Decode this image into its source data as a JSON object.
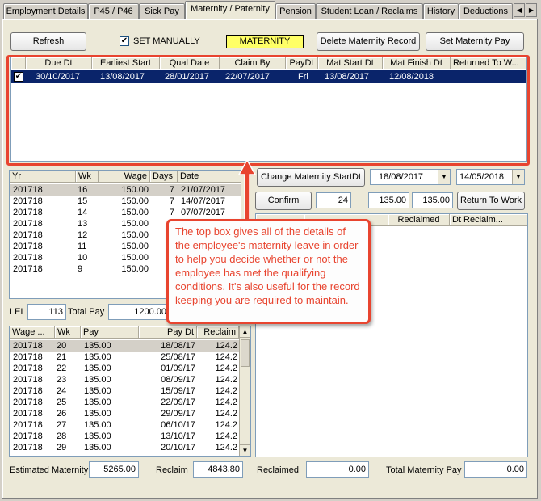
{
  "tabs": [
    "Employment Details",
    "P45 / P46",
    "Sick Pay",
    "Maternity / Paternity",
    "Pension",
    "Student Loan / Reclaims",
    "History",
    "Deductions"
  ],
  "toolbar": {
    "refresh": "Refresh",
    "set_manually": "SET MANUALLY",
    "maternity_badge": "MATERNITY",
    "delete_record": "Delete Maternity Record",
    "set_pay": "Set Maternity Pay"
  },
  "records": {
    "headers": [
      "Due Dt",
      "Earliest Start",
      "Qual Date",
      "Claim By",
      "PayDt",
      "Mat Start Dt",
      "Mat Finish Dt",
      "Returned To W..."
    ],
    "rows": [
      [
        "30/10/2017",
        "13/08/2017",
        "28/01/2017",
        "22/07/2017",
        "Fri",
        "13/08/2017",
        "12/08/2018",
        ""
      ]
    ]
  },
  "earnings": {
    "headers": [
      "Yr",
      "Wk",
      "Wage",
      "Days",
      "Date"
    ],
    "rows": [
      [
        "201718",
        "16",
        "150.00",
        "7",
        "21/07/2017"
      ],
      [
        "201718",
        "15",
        "150.00",
        "7",
        "14/07/2017"
      ],
      [
        "201718",
        "14",
        "150.00",
        "7",
        "07/07/2017"
      ],
      [
        "201718",
        "13",
        "150.00",
        "",
        ""
      ],
      [
        "201718",
        "12",
        "150.00",
        "",
        ""
      ],
      [
        "201718",
        "11",
        "150.00",
        "",
        ""
      ],
      [
        "201718",
        "10",
        "150.00",
        "",
        ""
      ],
      [
        "201718",
        "9",
        "150.00",
        "",
        ""
      ]
    ]
  },
  "lel": {
    "label": "LEL",
    "value": "113",
    "total_label": "Total Pay",
    "total_value": "1200.00"
  },
  "payments": {
    "headers": [
      "Wage ...",
      "Wk",
      "Pay",
      "Pay Dt",
      "Reclaim"
    ],
    "rows": [
      [
        "201718",
        "20",
        "135.00",
        "18/08/17",
        "124.2"
      ],
      [
        "201718",
        "21",
        "135.00",
        "25/08/17",
        "124.2"
      ],
      [
        "201718",
        "22",
        "135.00",
        "01/09/17",
        "124.2"
      ],
      [
        "201718",
        "23",
        "135.00",
        "08/09/17",
        "124.2"
      ],
      [
        "201718",
        "24",
        "135.00",
        "15/09/17",
        "124.2"
      ],
      [
        "201718",
        "25",
        "135.00",
        "22/09/17",
        "124.2"
      ],
      [
        "201718",
        "26",
        "135.00",
        "29/09/17",
        "124.2"
      ],
      [
        "201718",
        "27",
        "135.00",
        "06/10/17",
        "124.2"
      ],
      [
        "201718",
        "28",
        "135.00",
        "13/10/17",
        "124.2"
      ],
      [
        "201718",
        "29",
        "135.00",
        "20/10/17",
        "124.2"
      ]
    ]
  },
  "controls": {
    "change_start": "Change Maternity StartDt",
    "start_date": "18/08/2017",
    "end_date": "14/05/2018",
    "confirm": "Confirm",
    "weeks": "24",
    "amount1": "135.00",
    "amount2": "135.00",
    "return_to_work": "Return To Work"
  },
  "reclaim_grid": {
    "headers": [
      "",
      "",
      "Reclaimed",
      "Dt Reclaim..."
    ]
  },
  "totals": {
    "estimated_label": "Estimated Maternity",
    "estimated_value": "5265.00",
    "reclaim_label": "Reclaim",
    "reclaim_value": "4843.80",
    "reclaimed_label": "Reclaimed",
    "reclaimed_value": "0.00",
    "total_label": "Total Maternity Pay",
    "total_value": "0.00"
  },
  "annotation": "The top box gives all of the details of the employee's maternity leave in order to help you decide whether or not the employee has met the qualifying conditions. It's also useful for the record keeping you are required to maintain.",
  "colors": {
    "annotation": "#e8442f",
    "selection": "#0a246a",
    "badge": "#ffff66"
  }
}
